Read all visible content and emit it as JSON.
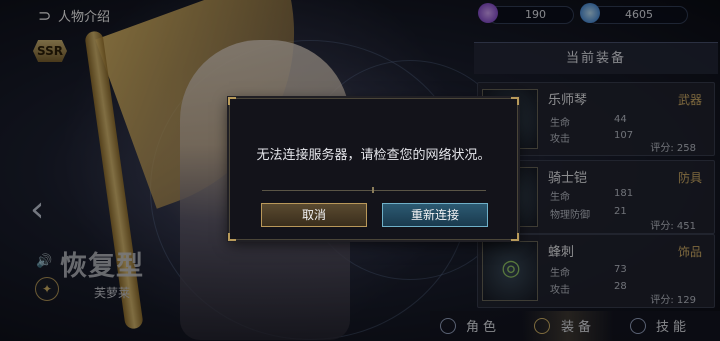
{
  "header": {
    "back_icon": "back-arrow-icon",
    "title": "人物介绍"
  },
  "hero": {
    "rarity": "SSR",
    "type_label": "恢复型",
    "name": "芙萝莱"
  },
  "resources": [
    {
      "icon": "purple-crystal-icon",
      "value": "190",
      "color": "#9b5cf0"
    },
    {
      "icon": "blue-gem-icon",
      "value": "4605",
      "color": "#3fa7ff"
    }
  ],
  "equipment": {
    "title": "当前装备",
    "items": [
      {
        "icon": "harp-icon",
        "name": "乐师琴",
        "type": "武器",
        "stats": [
          {
            "label": "生命",
            "value": "44"
          },
          {
            "label": "攻击",
            "value": "107"
          }
        ],
        "score": "评分: 258"
      },
      {
        "icon": "armor-icon",
        "name": "骑士铠",
        "type": "防具",
        "stats": [
          {
            "label": "生命",
            "value": "181"
          },
          {
            "label": "物理防御",
            "value": "21"
          }
        ],
        "score": "评分: 451"
      },
      {
        "icon": "ring-icon",
        "name": "蜂刺",
        "type": "饰品",
        "stats": [
          {
            "label": "生命",
            "value": "73"
          },
          {
            "label": "攻击",
            "value": "28"
          }
        ],
        "score": "评分: 129"
      }
    ]
  },
  "tabs": [
    {
      "label": "角色",
      "icon": "character-icon",
      "active": false
    },
    {
      "label": "装备",
      "icon": "equipment-icon",
      "active": true
    },
    {
      "label": "技能",
      "icon": "skill-icon",
      "active": false
    }
  ],
  "dialog": {
    "message": "无法连接服务器，请检查您的网络状况。",
    "cancel_label": "取消",
    "retry_label": "重新连接"
  },
  "colors": {
    "accent_gold": "#b89a5a",
    "accent_blue": "#6fb0c8",
    "item_type": "#d8b36a"
  }
}
